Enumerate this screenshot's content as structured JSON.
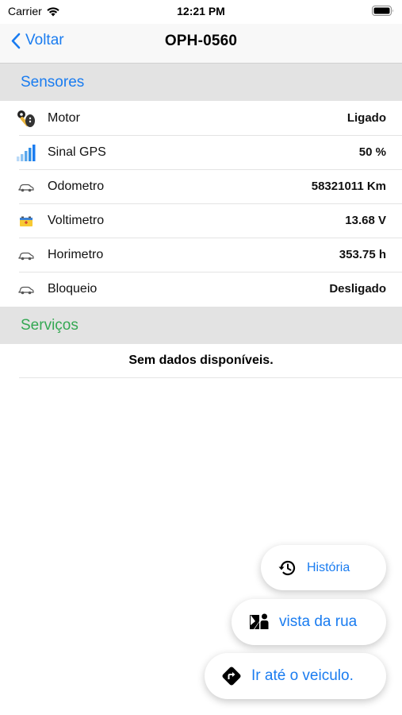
{
  "status_bar": {
    "carrier": "Carrier",
    "time": "12:21 PM"
  },
  "nav": {
    "back_label": "Voltar",
    "title": "OPH-0560",
    "accent": "#1a7cf0"
  },
  "sensores": {
    "header": "Sensores",
    "header_color": "#1a7cf0",
    "rows": [
      {
        "icon": "car-key-icon",
        "label": "Motor",
        "value": "Ligado"
      },
      {
        "icon": "signal-bars-icon",
        "label": "Sinal GPS",
        "value": "50 %"
      },
      {
        "icon": "car-icon",
        "label": "Odometro",
        "value": "58321011 Km"
      },
      {
        "icon": "battery-icon",
        "label": "Voltimetro",
        "value": "13.68 V"
      },
      {
        "icon": "car-icon",
        "label": "Horimetro",
        "value": "353.75 h"
      },
      {
        "icon": "car-icon",
        "label": "Bloqueio",
        "value": "Desligado"
      }
    ]
  },
  "servicos": {
    "header": "Serviços",
    "header_color": "#34a853",
    "empty_message": "Sem dados disponíveis."
  },
  "actions": {
    "historia": {
      "label": "História",
      "icon": "history-icon"
    },
    "vista_rua": {
      "label": "vista da rua",
      "icon": "street-view-icon"
    },
    "ir_veiculo": {
      "label": "Ir até o veiculo.",
      "icon": "directions-icon"
    }
  }
}
